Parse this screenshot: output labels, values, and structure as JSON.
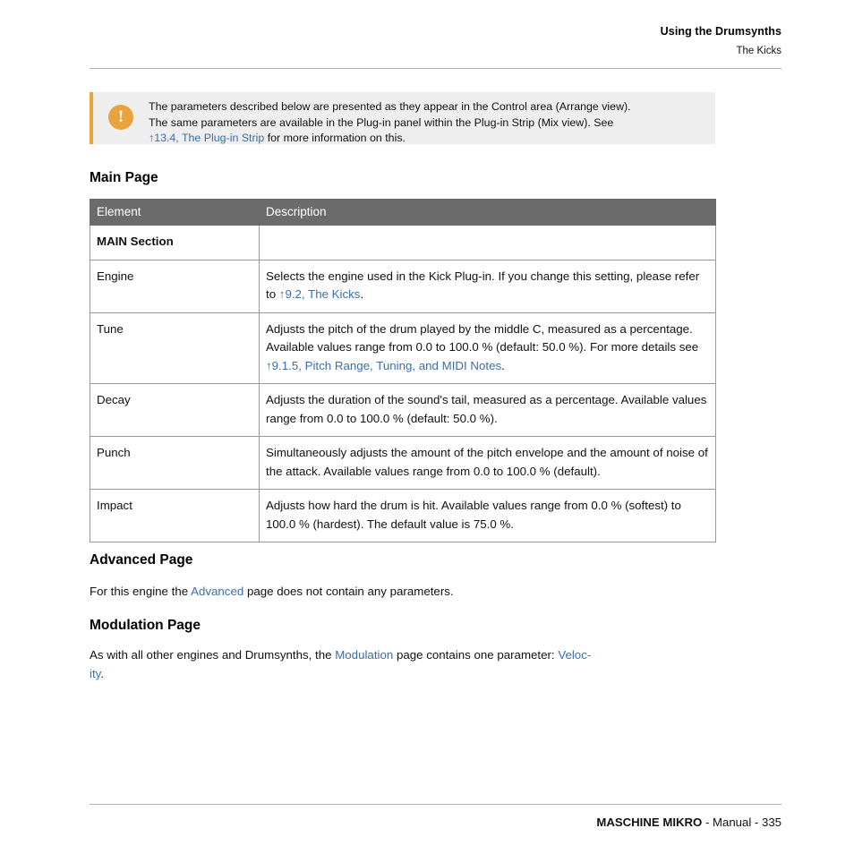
{
  "header": {
    "title": "Using the Drumsynths",
    "subtitle": "The Kicks"
  },
  "note": {
    "icon": "warning-exclamation-icon",
    "line1": "The parameters described below are presented as they appear in the Control area (Arrange view).",
    "line2": "The same parameters are available in the Plug-in panel within the Plug-in Strip (Mix view). See",
    "link": "↑13.4, The Plug-in Strip",
    "line3_tail": " for more information on this.",
    "accent_color": "#e8a33d",
    "background_color": "#eeeeee"
  },
  "sections": {
    "main_page_heading": "Main Page",
    "advanced_page_heading": "Advanced Page",
    "modulation_page_heading": "Modulation Page"
  },
  "table": {
    "headers": [
      "Element",
      "Description"
    ],
    "header_bg": "#6b6b6b",
    "link_color": "#3b6ea8",
    "rows": [
      {
        "type": "section",
        "element": "MAIN Section",
        "description": ""
      },
      {
        "type": "param",
        "element": "Engine",
        "desc_pre": "Selects the engine used in the Kick Plug-in. If you change this setting, please refer to ",
        "desc_link": "↑9.2, The Kicks",
        "desc_post": "."
      },
      {
        "type": "param",
        "element": "Tune",
        "desc_pre": "Adjusts the pitch of the drum played by the middle C, measured as a percentage. Available values range from 0.0 to 100.0 % (default: 50.0 %). For more details see ",
        "desc_link": "↑9.1.5, Pitch Range, Tuning, and MIDI Notes",
        "desc_post": "."
      },
      {
        "type": "param",
        "element": "Decay",
        "desc_pre": "Adjusts the duration of the sound's tail, measured as a percentage. Available values range from 0.0 to 100.0 % (default: 50.0 %).",
        "desc_link": "",
        "desc_post": ""
      },
      {
        "type": "param",
        "element": "Punch",
        "desc_pre": "Simultaneously adjusts the amount of the pitch envelope and the amount of noise of the attack. Available values range from 0.0 to 100.0 % (default).",
        "desc_link": "",
        "desc_post": ""
      },
      {
        "type": "param",
        "element": "Impact",
        "desc_pre": "Adjusts how hard the drum is hit. Available values range from 0.0 % (softest) to 100.0 % (hardest). The default value is 75.0 %.",
        "desc_link": "",
        "desc_post": ""
      }
    ]
  },
  "advanced_paragraph": {
    "pre": "For this engine the ",
    "link": "Advanced",
    "post": " page does not contain any parameters."
  },
  "modulation_paragraph": {
    "pre": "As with all other engines and Drumsynths, the ",
    "link1": "Modulation",
    "mid": " page contains one parameter: ",
    "link2": "Veloc-",
    "link2_cont": "ity",
    "post": "."
  },
  "footer": {
    "product": "MASCHINE MIKRO",
    "tail": " - Manual - 335"
  }
}
